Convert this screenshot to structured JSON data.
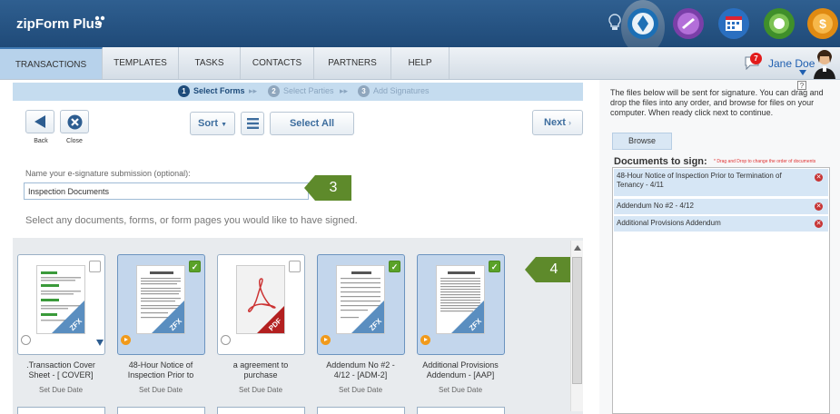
{
  "app": {
    "title": "zipForm Plus"
  },
  "nav": {
    "tabs": [
      "TRANSACTIONS",
      "TEMPLATES",
      "TASKS",
      "CONTACTS",
      "PARTNERS",
      "HELP"
    ],
    "notif_count": "7",
    "user_name": "Jane Doe"
  },
  "steps": [
    {
      "num": "1",
      "label": "Select Forms"
    },
    {
      "num": "2",
      "label": "Select Parties"
    },
    {
      "num": "3",
      "label": "Add Signatures"
    }
  ],
  "toolbar": {
    "back": "Back",
    "close": "Close",
    "sort": "Sort",
    "select_all": "Select All",
    "next": "Next"
  },
  "submission": {
    "label": "Name your e-signature submission (optional):",
    "value": "Inspection Documents"
  },
  "instructions": "Select any documents, forms, or form pages you would like to have signed.",
  "callouts": {
    "a": "3",
    "b": "4"
  },
  "forms": [
    {
      "name_line1": ".Transaction Cover",
      "name_line2": "Sheet - [ COVER]",
      "due": "Set Due Date",
      "selected": false,
      "type": "ZFX"
    },
    {
      "name_line1": "48-Hour Notice of",
      "name_line2": "Inspection Prior to",
      "due": "Set Due Date",
      "selected": true,
      "type": "ZFX"
    },
    {
      "name_line1": "a agreement to",
      "name_line2": "purchase",
      "due": "Set Due Date",
      "selected": false,
      "type": "PDF"
    },
    {
      "name_line1": "Addendum No #2 -",
      "name_line2": "4/12 - [ADM-2]",
      "due": "Set Due Date",
      "selected": true,
      "type": "ZFX"
    },
    {
      "name_line1": "Additional Provisions",
      "name_line2": "Addendum - [AAP]",
      "due": "Set Due Date",
      "selected": true,
      "type": "ZFX"
    }
  ],
  "right": {
    "info": "The files below will be sent for signature. You can drag and drop the files into any order, and browse for files on your computer. When ready click next to continue.",
    "browse": "Browse",
    "docs_title": "Documents to sign:",
    "dnd_hint": "* Drag and Drop to change the order of documents",
    "docs": [
      "48-Hour Notice of Inspection Prior to Termination of Tenancy - 4/11",
      "Addendum No #2 - 4/12",
      "Additional Provisions Addendum"
    ]
  },
  "colors": {
    "header": "#1f4a78",
    "accent": "#3d6d9e",
    "callout": "#5e8a2b",
    "selected_card": "#c3d6ec"
  }
}
